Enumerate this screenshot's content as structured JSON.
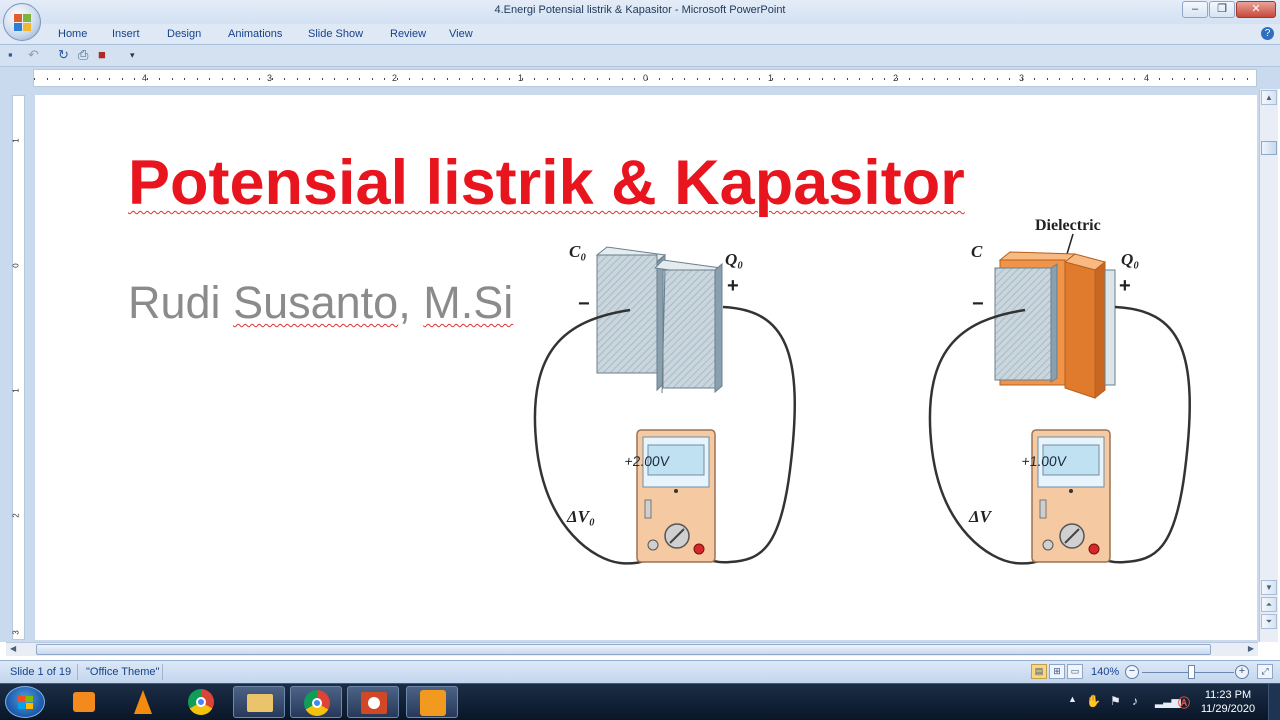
{
  "app": {
    "window_title": "4.Energi Potensial listrik & Kapasitor - Microsoft PowerPoint",
    "ribbon_tabs": [
      "Home",
      "Insert",
      "Design",
      "Animations",
      "Slide Show",
      "Review",
      "View"
    ]
  },
  "ruler": {
    "horizontal_labels": [
      "4",
      "3",
      "2",
      "1",
      "0",
      "1",
      "2",
      "3",
      "4"
    ],
    "vertical_labels": [
      "1",
      "0",
      "1",
      "2",
      "3"
    ]
  },
  "slide": {
    "title": "Potensial listrik & Kapasitor",
    "subtitle_part1": "Rudi",
    "subtitle_part2": "Susanto",
    "subtitle_part3": ",",
    "subtitle_part4": "M.Si",
    "figure": {
      "left_cap_label": "C₀",
      "left_charge_label": "Q₀",
      "left_meter_reading": "+2.00V",
      "left_dv_label": "ΔV₀",
      "dielectric_label": "Dielectric",
      "right_cap_label": "C",
      "right_charge_label": "Q₀",
      "right_meter_reading": "+1.00V",
      "right_dv_label": "ΔV",
      "minus": "−",
      "plus": "+"
    }
  },
  "status": {
    "slide_indicator": "Slide 1 of 19",
    "theme": "\"Office Theme\"",
    "zoom": "140%"
  },
  "taskbar": {
    "time": "11:23 PM",
    "date": "11/29/2020",
    "pinned": [
      "windows-media-player",
      "vlc",
      "chrome",
      "file-explorer",
      "chrome-open",
      "powerpoint-open",
      "pdf-app-open"
    ]
  },
  "colors": {
    "title_red": "#e8141e",
    "subtitle_gray": "#8b8b8b",
    "ribbon_text": "#15428b",
    "dielectric_orange": "#f0944a",
    "meter_body": "#f7d4b0"
  }
}
